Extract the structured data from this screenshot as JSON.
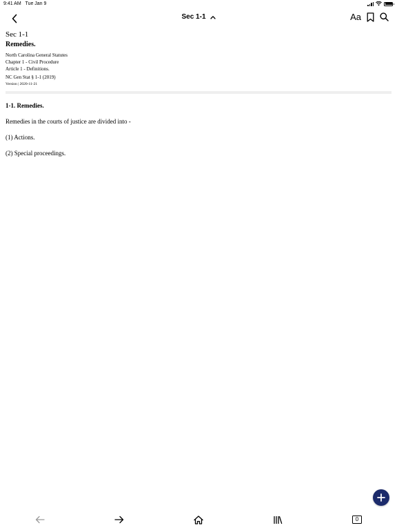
{
  "status_bar": {
    "time": "9:41 AM",
    "date": "Tue Jan 9"
  },
  "nav": {
    "title": "Sec 1-1",
    "font_button": "Aa"
  },
  "header": {
    "section_label": "Sec 1-1",
    "section_title": "Remedies.",
    "meta_lines": [
      "North Carolina General Statutes",
      "Chapter 1 - Civil Procedure",
      "Article 1 - Definitions.",
      "NC Gen Stat § 1-1 (2019)"
    ],
    "version": "Version | 2020-11-21"
  },
  "body": {
    "heading": "1-1. Remedies.",
    "paragraphs": [
      "Remedies in the courts of justice are divided into -",
      "(1) Actions.",
      "(2) Special proceedings."
    ]
  },
  "toolbar": {
    "tab_count": "0"
  },
  "colors": {
    "fab": "#1c2b6b",
    "divider": "#efefef"
  },
  "icons": {
    "back": "chevron-left-icon",
    "title_toggle": "chevron-up-icon",
    "bookmark": "bookmark-icon",
    "search": "search-icon",
    "add": "plus-icon",
    "history_back": "arrow-left-icon",
    "history_forward": "arrow-right-icon",
    "home": "home-icon",
    "library": "library-icon",
    "tabs": "tabs-icon"
  }
}
